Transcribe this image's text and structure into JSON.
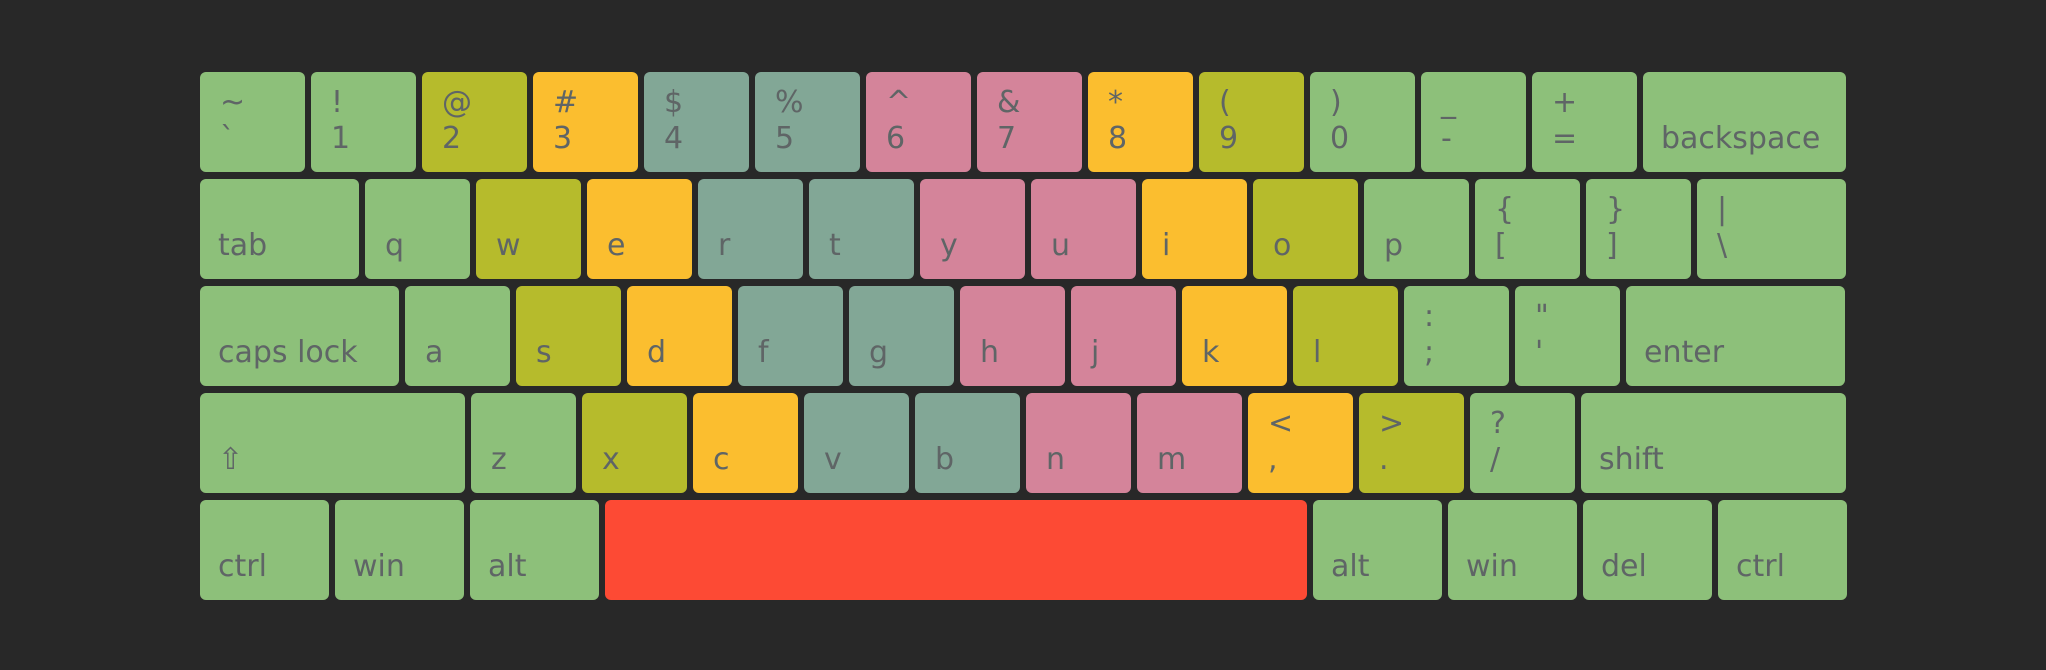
{
  "colors": {
    "background": "#282828",
    "text": "#5f6566",
    "green": "#8dc07a",
    "olive": "#b6bb2c",
    "yellow": "#fbbe2f",
    "teal": "#82a796",
    "pink": "#d4849a",
    "red": "#fd4a34"
  },
  "keyboard": {
    "rows": [
      [
        {
          "top": "~",
          "bottom": "`",
          "color": "green",
          "w": 105
        },
        {
          "top": "!",
          "bottom": "1",
          "color": "green",
          "w": 105
        },
        {
          "top": "@",
          "bottom": "2",
          "color": "olive",
          "w": 105
        },
        {
          "top": "#",
          "bottom": "3",
          "color": "yellow",
          "w": 105
        },
        {
          "top": "$",
          "bottom": "4",
          "color": "teal",
          "w": 105
        },
        {
          "top": "%",
          "bottom": "5",
          "color": "teal",
          "w": 105
        },
        {
          "top": "^",
          "bottom": "6",
          "color": "pink",
          "w": 105
        },
        {
          "top": "&",
          "bottom": "7",
          "color": "pink",
          "w": 105
        },
        {
          "top": "*",
          "bottom": "8",
          "color": "yellow",
          "w": 105
        },
        {
          "top": "(",
          "bottom": "9",
          "color": "olive",
          "w": 105
        },
        {
          "top": ")",
          "bottom": "0",
          "color": "green",
          "w": 105
        },
        {
          "top": "_",
          "bottom": "-",
          "color": "green",
          "w": 105
        },
        {
          "top": "+",
          "bottom": "=",
          "color": "green",
          "w": 105
        },
        {
          "top": "",
          "bottom": "backspace",
          "color": "green",
          "w": 203,
          "wide": true
        }
      ],
      [
        {
          "top": "",
          "bottom": "tab",
          "color": "green",
          "w": 159,
          "wide": true
        },
        {
          "top": "",
          "bottom": "q",
          "color": "green",
          "w": 105
        },
        {
          "top": "",
          "bottom": "w",
          "color": "olive",
          "w": 105
        },
        {
          "top": "",
          "bottom": "e",
          "color": "yellow",
          "w": 105
        },
        {
          "top": "",
          "bottom": "r",
          "color": "teal",
          "w": 105
        },
        {
          "top": "",
          "bottom": "t",
          "color": "teal",
          "w": 105
        },
        {
          "top": "",
          "bottom": "y",
          "color": "pink",
          "w": 105
        },
        {
          "top": "",
          "bottom": "u",
          "color": "pink",
          "w": 105
        },
        {
          "top": "",
          "bottom": "i",
          "color": "yellow",
          "w": 105
        },
        {
          "top": "",
          "bottom": "o",
          "color": "olive",
          "w": 105
        },
        {
          "top": "",
          "bottom": "p",
          "color": "green",
          "w": 105
        },
        {
          "top": "{",
          "bottom": "[",
          "color": "green",
          "w": 105
        },
        {
          "top": "}",
          "bottom": "]",
          "color": "green",
          "w": 105
        },
        {
          "top": "|",
          "bottom": "\\",
          "color": "green",
          "w": 149
        }
      ],
      [
        {
          "top": "",
          "bottom": "caps lock",
          "color": "green",
          "w": 199,
          "wide": true
        },
        {
          "top": "",
          "bottom": "a",
          "color": "green",
          "w": 105
        },
        {
          "top": "",
          "bottom": "s",
          "color": "olive",
          "w": 105
        },
        {
          "top": "",
          "bottom": "d",
          "color": "yellow",
          "w": 105
        },
        {
          "top": "",
          "bottom": "f",
          "color": "teal",
          "w": 105
        },
        {
          "top": "",
          "bottom": "g",
          "color": "teal",
          "w": 105
        },
        {
          "top": "",
          "bottom": "h",
          "color": "pink",
          "w": 105
        },
        {
          "top": "",
          "bottom": "j",
          "color": "pink",
          "w": 105
        },
        {
          "top": "",
          "bottom": "k",
          "color": "yellow",
          "w": 105
        },
        {
          "top": "",
          "bottom": "l",
          "color": "olive",
          "w": 105
        },
        {
          "top": ":",
          "bottom": ";",
          "color": "green",
          "w": 105
        },
        {
          "top": "\"",
          "bottom": "'",
          "color": "green",
          "w": 105
        },
        {
          "top": "",
          "bottom": "enter",
          "color": "green",
          "w": 219,
          "wide": true
        }
      ],
      [
        {
          "top": "",
          "bottom": "⇧",
          "color": "green",
          "w": 265,
          "wide": true
        },
        {
          "top": "",
          "bottom": "z",
          "color": "green",
          "w": 105
        },
        {
          "top": "",
          "bottom": "x",
          "color": "olive",
          "w": 105
        },
        {
          "top": "",
          "bottom": "c",
          "color": "yellow",
          "w": 105
        },
        {
          "top": "",
          "bottom": "v",
          "color": "teal",
          "w": 105
        },
        {
          "top": "",
          "bottom": "b",
          "color": "teal",
          "w": 105
        },
        {
          "top": "",
          "bottom": "n",
          "color": "pink",
          "w": 105
        },
        {
          "top": "",
          "bottom": "m",
          "color": "pink",
          "w": 105
        },
        {
          "top": "<",
          "bottom": ",",
          "color": "yellow",
          "w": 105
        },
        {
          "top": ">",
          "bottom": ".",
          "color": "olive",
          "w": 105
        },
        {
          "top": "?",
          "bottom": "/",
          "color": "green",
          "w": 105
        },
        {
          "top": "",
          "bottom": "shift",
          "color": "green",
          "w": 265,
          "wide": true
        }
      ],
      [
        {
          "top": "",
          "bottom": "ctrl",
          "color": "green",
          "w": 129,
          "wide": true
        },
        {
          "top": "",
          "bottom": "win",
          "color": "green",
          "w": 129,
          "wide": true
        },
        {
          "top": "",
          "bottom": "alt",
          "color": "green",
          "w": 129,
          "wide": true
        },
        {
          "top": "",
          "bottom": "",
          "color": "red",
          "w": 702,
          "space": true
        },
        {
          "top": "",
          "bottom": "alt",
          "color": "green",
          "w": 129,
          "wide": true
        },
        {
          "top": "",
          "bottom": "win",
          "color": "green",
          "w": 129,
          "wide": true
        },
        {
          "top": "",
          "bottom": "del",
          "color": "green",
          "w": 129,
          "wide": true
        },
        {
          "top": "",
          "bottom": "ctrl",
          "color": "green",
          "w": 129,
          "wide": true
        }
      ]
    ]
  }
}
